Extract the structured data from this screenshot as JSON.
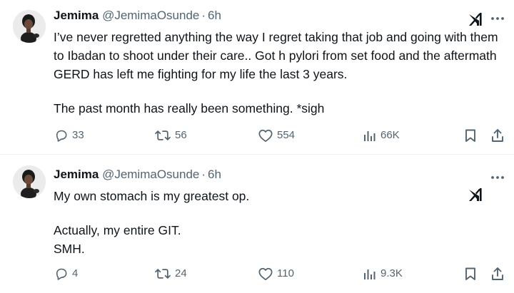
{
  "tweets": [
    {
      "author": "Jemima",
      "handle": "@JemimaOsunde",
      "separator": "·",
      "time": "6h",
      "paragraphs": [
        "I’ve never regretted anything the way I regret taking that job and going with them to Ibadan to shoot under their care.. Got h pylori from set food and the aftermath GERD has left me fighting for my life the last 3 years.",
        "The past month has really been something. *sigh"
      ],
      "replies": "33",
      "reposts": "56",
      "likes": "554",
      "views": "66K"
    },
    {
      "author": "Jemima",
      "handle": "@JemimaOsunde",
      "separator": "·",
      "time": "6h",
      "paragraphs": [
        "My own stomach is my greatest op.",
        "Actually, my entire GIT.",
        "SMH."
      ],
      "replies": "4",
      "reposts": "24",
      "likes": "110",
      "views": "9.3K"
    }
  ],
  "icons": {
    "xai": "grok-xai-icon",
    "more": "more-icon",
    "reply": "reply-icon",
    "repost": "repost-icon",
    "like": "like-icon",
    "views": "views-icon",
    "bookmark": "bookmark-icon",
    "share": "share-icon"
  },
  "colors": {
    "text": "#0f1419",
    "secondary": "#536471",
    "divider": "#eff3f4"
  }
}
